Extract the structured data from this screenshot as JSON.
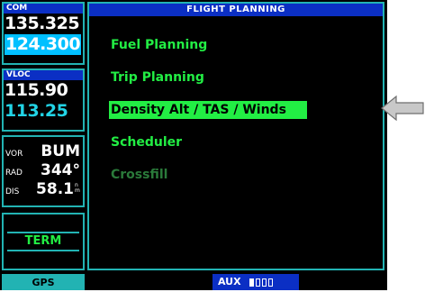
{
  "com": {
    "header": "COM",
    "active": "135.325",
    "standby": "124.300"
  },
  "vloc": {
    "header": "VLOC",
    "active": "115.90",
    "standby": "113.25"
  },
  "nav": {
    "vor_label": "VOR",
    "vor_value": "BUM",
    "rad_label": "RAD",
    "rad_value": "344°",
    "dis_label": "DIS",
    "dis_value": "58.1",
    "dis_unit": "n m"
  },
  "cdi": {
    "mode": "TERM"
  },
  "page": {
    "title": "FLIGHT PLANNING",
    "menu": [
      {
        "label": "Fuel Planning",
        "state": "normal"
      },
      {
        "label": "Trip Planning",
        "state": "normal"
      },
      {
        "label": "Density Alt / TAS / Winds",
        "state": "selected"
      },
      {
        "label": "Scheduler",
        "state": "normal"
      },
      {
        "label": "Crossfill",
        "state": "disabled"
      }
    ]
  },
  "bottom": {
    "gps_label": "GPS",
    "aux_label": "AUX",
    "page_count": 4,
    "current_page": 1
  },
  "colors": {
    "cyan": "#22b3b3",
    "green": "#22ee44",
    "blue": "#0b2fc4",
    "highlight": "#00c0ff"
  },
  "icons": {
    "pointer": "pointer-arrow-icon"
  }
}
